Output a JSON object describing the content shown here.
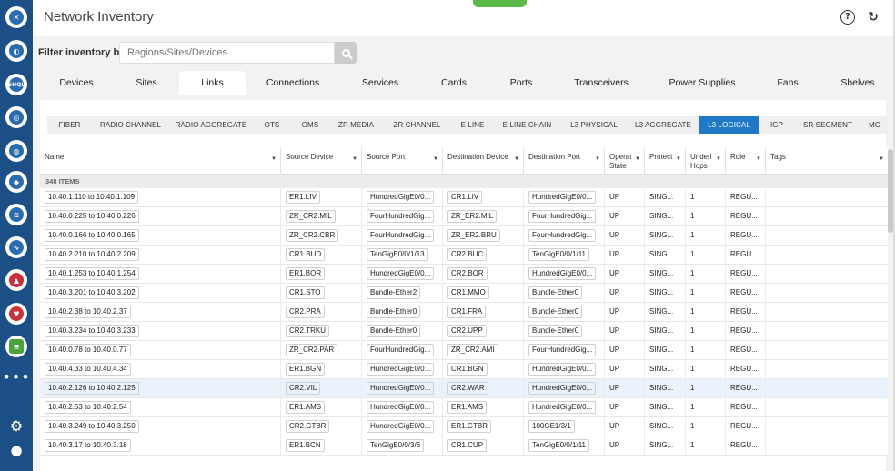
{
  "app": {
    "title": "Network Inventory"
  },
  "rail": {
    "items": [
      "app-logo-icon",
      "topology-icon",
      "shql-icon",
      "inventory-icon",
      "links-icon",
      "map-icon",
      "layers-icon",
      "performance-icon",
      "alarms-icon",
      "health-icon",
      "reports-icon",
      "more-icon",
      "settings-icon",
      "user-icon"
    ],
    "shql_label": "SHQL"
  },
  "header": {
    "help_glyph": "?",
    "refresh_glyph": "↻"
  },
  "filter": {
    "label": "Filter inventory by:",
    "placeholder": "Regions/Sites/Devices"
  },
  "main_tabs": [
    "Devices",
    "Sites",
    "Links",
    "Connections",
    "Services",
    "Cards",
    "Ports",
    "Transceivers",
    "Power Supplies",
    "Fans",
    "Shelves"
  ],
  "main_tab_active": "Links",
  "sub_tabs": [
    "FIBER",
    "RADIO CHANNEL",
    "RADIO AGGREGATE",
    "OTS",
    "OMS",
    "ZR MEDIA",
    "ZR CHANNEL",
    "E LINE",
    "E LINE CHAIN",
    "L3 PHYSICAL",
    "L3 AGGREGATE",
    "L3 LOGICAL",
    "IGP",
    "SR SEGMENT",
    "MC"
  ],
  "sub_tab_active": "L3 LOGICAL",
  "grid": {
    "columns": [
      "Name",
      "Source Device",
      "Source Port",
      "Destination Device",
      "Destination Port",
      "Operat State",
      "Protect",
      "Underl Hops",
      "Role",
      "Tags"
    ],
    "item_count": "348 ITEMS",
    "rows": [
      [
        "10.40.1.110 to 10.40.1.109",
        "ER1.LIV",
        "HundredGigE0/0...",
        "CR1.LIV",
        "HundredGigE0/0...",
        "UP",
        "SING...",
        "1",
        "REGU...",
        ""
      ],
      [
        "10.40.0.225 to 10.40.0.226",
        "ZR_CR2.MIL",
        "FourHundredGig...",
        "ZR_ER2.MIL",
        "FourHundredGig...",
        "UP",
        "SING...",
        "1",
        "REGU...",
        ""
      ],
      [
        "10.40.0.166 to 10.40.0.165",
        "ZR_CR2.CBR",
        "FourHundredGig...",
        "ZR_ER2.BRU",
        "FourHundredGig...",
        "UP",
        "SING...",
        "1",
        "REGU...",
        ""
      ],
      [
        "10.40.2.210 to 10.40.2.209",
        "CR1.BUD",
        "TenGigE0/0/1/13",
        "CR2.BUC",
        "TenGigE0/0/1/11",
        "UP",
        "SING...",
        "1",
        "REGU...",
        ""
      ],
      [
        "10.40.1.253 to 10.40.1.254",
        "ER1.BOR",
        "HundredGigE0/0...",
        "CR2.BOR",
        "HundredGigE0/0...",
        "UP",
        "SING...",
        "1",
        "REGU...",
        ""
      ],
      [
        "10.40.3.201 to 10.40.3.202",
        "CR1.STO",
        "Bundle-Ether2",
        "CR1.MMO",
        "Bundle-Ether0",
        "UP",
        "SING...",
        "1",
        "REGU...",
        ""
      ],
      [
        "10.40.2.38 to 10.40.2.37",
        "CR2.PRA",
        "Bundle-Ether0",
        "CR1.FRA",
        "Bundle-Ether0",
        "UP",
        "SING...",
        "1",
        "REGU...",
        ""
      ],
      [
        "10.40.3.234 to 10.40.3.233",
        "CR2.TRKU",
        "Bundle-Ether0",
        "CR2.UPP",
        "Bundle-Ether0",
        "UP",
        "SING...",
        "1",
        "REGU...",
        ""
      ],
      [
        "10.40.0.78 to 10.40.0.77",
        "ZR_CR2.PAR",
        "FourHundredGig...",
        "ZR_CR2.AMI",
        "FourHundredGig...",
        "UP",
        "SING...",
        "1",
        "REGU...",
        ""
      ],
      [
        "10.40.4.33 to 10.40.4.34",
        "ER1.BGN",
        "HundredGigE0/0...",
        "CR1.BGN",
        "HundredGigE0/0...",
        "UP",
        "SING...",
        "1",
        "REGU...",
        ""
      ],
      [
        "10.40.2.126 to 10.40.2.125",
        "CR2.VIL",
        "HundredGigE0/0...",
        "CR2.WAR",
        "HundredGigE0/0...",
        "UP",
        "SING...",
        "1",
        "REGU...",
        ""
      ],
      [
        "10.40.2.53 to 10.40.2.54",
        "ER1.AMS",
        "HundredGigE0/0...",
        "ER1.AMS",
        "HundredGigE0/0...",
        "UP",
        "SING...",
        "1",
        "REGU...",
        ""
      ],
      [
        "10.40.3.249 to 10.40.3.250",
        "CR2.GTBR",
        "HundredGigE0/0...",
        "ER1.GTBR",
        "100GE1/3/1",
        "UP",
        "SING...",
        "1",
        "REGU...",
        ""
      ],
      [
        "10.40.3.17 to 10.40.3.18",
        "ER1.BCN",
        "TenGigE0/0/3/6",
        "CR1.CUP",
        "TenGigE0/0/1/11",
        "UP",
        "SING...",
        "1",
        "REGU...",
        ""
      ]
    ],
    "selected_row": 10
  },
  "colors": {
    "rail": "#1c4f86",
    "accent": "#1f78c8",
    "tab_accent": "#5bbb4a"
  }
}
